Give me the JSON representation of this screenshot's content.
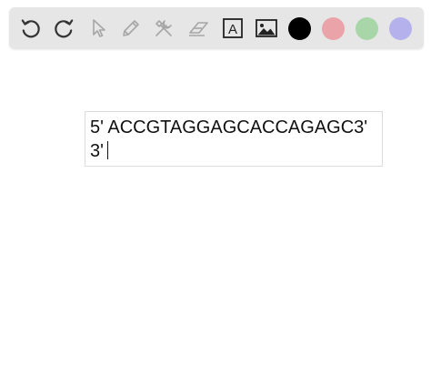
{
  "toolbar": {
    "tools": [
      {
        "name": "undo-icon"
      },
      {
        "name": "redo-icon"
      },
      {
        "name": "select-pointer-icon"
      },
      {
        "name": "pen-icon"
      },
      {
        "name": "tools-icon"
      },
      {
        "name": "eraser-icon"
      },
      {
        "name": "text-box-icon",
        "glyph": "A"
      },
      {
        "name": "image-icon"
      }
    ],
    "colors": [
      "#000000",
      "#e9a3a9",
      "#a9d6a9",
      "#b4b1ec"
    ],
    "selected_color": "#000000"
  },
  "editor": {
    "line1": "5' ACCGTAGGAGCACCAGAGC3'",
    "line2": "3'"
  }
}
